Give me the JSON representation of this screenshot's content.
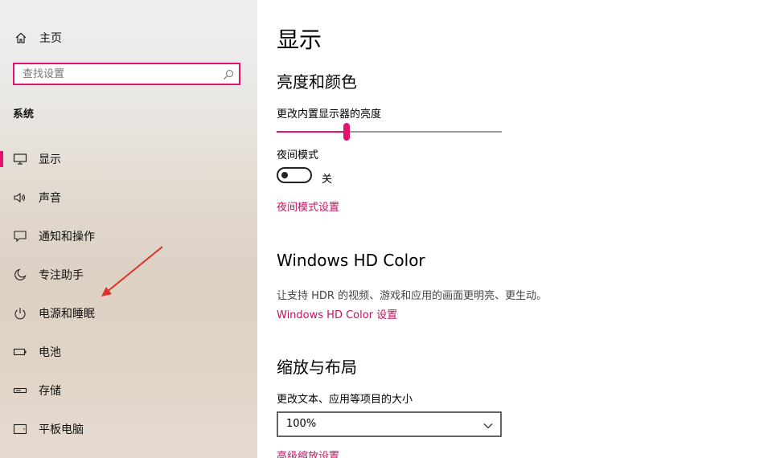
{
  "sidebar": {
    "home_label": "主页",
    "search_placeholder": "查找设置",
    "section_title": "系统",
    "items": [
      {
        "label": "显示",
        "icon": "monitor-icon"
      },
      {
        "label": "声音",
        "icon": "speaker-icon"
      },
      {
        "label": "通知和操作",
        "icon": "notification-icon"
      },
      {
        "label": "专注助手",
        "icon": "moon-icon"
      },
      {
        "label": "电源和睡眠",
        "icon": "power-icon"
      },
      {
        "label": "电池",
        "icon": "battery-icon"
      },
      {
        "label": "存储",
        "icon": "storage-icon"
      },
      {
        "label": "平板电脑",
        "icon": "tablet-icon"
      }
    ],
    "selected_index": 0
  },
  "content": {
    "title": "显示",
    "brightness_section": {
      "heading": "亮度和颜色",
      "slider_label": "更改内置显示器的亮度",
      "slider_value": 0.31
    },
    "night_mode": {
      "label": "夜间模式",
      "state_label": "关",
      "link": "夜间模式设置"
    },
    "hd_color": {
      "heading": "Windows HD Color",
      "description": "让支持 HDR 的视频、游戏和应用的画面更明亮、更生动。",
      "link": "Windows HD Color 设置"
    },
    "scale_layout": {
      "heading": "缩放与布局",
      "label": "更改文本、应用等项目的大小",
      "selected_value": "100%",
      "link": "高级缩放设置"
    }
  },
  "colors": {
    "accent": "#e3126d",
    "link": "#c3115f",
    "annotation_arrow": "#e0302a"
  }
}
